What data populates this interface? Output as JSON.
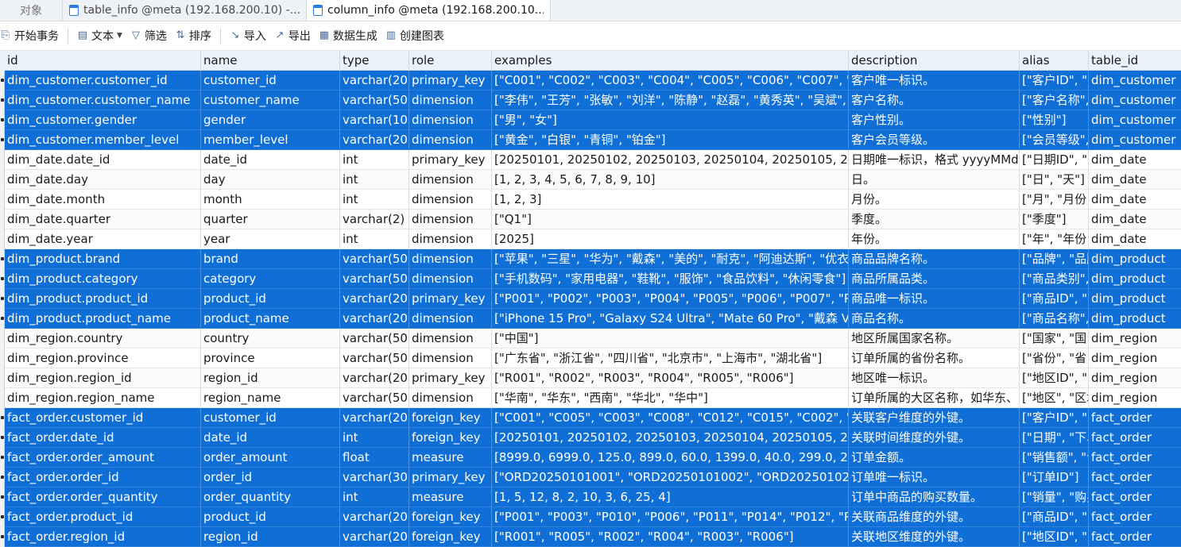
{
  "tabs": [
    {
      "label": "对象"
    },
    {
      "label": "table_info @meta (192.168.200.10) -..."
    },
    {
      "label": "column_info @meta (192.168.200.10..."
    }
  ],
  "toolbar": {
    "begin_transaction": "开始事务",
    "text": "文本",
    "filter": "筛选",
    "sort": "排序",
    "import": "导入",
    "export": "导出",
    "data_generation": "数据生成",
    "create_chart": "创建图表"
  },
  "grid": {
    "columns": [
      "id",
      "name",
      "type",
      "role",
      "examples",
      "description",
      "alias",
      "table_id"
    ],
    "rows": [
      {
        "selected": true,
        "id": "dim_customer.customer_id",
        "name": "customer_id",
        "type": "varchar(20)",
        "role": "primary_key",
        "examples": "[\"C001\", \"C002\", \"C003\", \"C004\", \"C005\", \"C006\", \"C007\", \"C0",
        "description": "客户唯一标识。",
        "alias": "[\"客户ID\", \"",
        "table_id": "dim_customer"
      },
      {
        "selected": true,
        "id": "dim_customer.customer_name",
        "name": "customer_name",
        "type": "varchar(50)",
        "role": "dimension",
        "examples": "[\"李伟\", \"王芳\", \"张敏\", \"刘洋\", \"陈静\", \"赵磊\", \"黄秀英\", \"吴斌\", \"",
        "description": "客户名称。",
        "alias": "[\"客户名称\",",
        "table_id": "dim_customer"
      },
      {
        "selected": true,
        "id": "dim_customer.gender",
        "name": "gender",
        "type": "varchar(10)",
        "role": "dimension",
        "examples": "[\"男\", \"女\"]",
        "description": "客户性别。",
        "alias": "[\"性别\"]",
        "table_id": "dim_customer"
      },
      {
        "selected": true,
        "id": "dim_customer.member_level",
        "name": "member_level",
        "type": "varchar(20)",
        "role": "dimension",
        "examples": "[\"黄金\", \"白银\", \"青铜\", \"铂金\"]",
        "description": "客户会员等级。",
        "alias": "[\"会员等级\",",
        "table_id": "dim_customer"
      },
      {
        "selected": false,
        "id": "dim_date.date_id",
        "name": "date_id",
        "type": "int",
        "role": "primary_key",
        "examples": "[20250101, 20250102, 20250103, 20250104, 20250105, 20250",
        "description": "日期唯一标识，格式 yyyyMMd",
        "alias": "[\"日期ID\", \"",
        "table_id": "dim_date"
      },
      {
        "selected": false,
        "id": "dim_date.day",
        "name": "day",
        "type": "int",
        "role": "dimension",
        "examples": "[1, 2, 3, 4, 5, 6, 7, 8, 9, 10]",
        "description": "日。",
        "alias": "[\"日\", \"天\"]",
        "table_id": "dim_date"
      },
      {
        "selected": false,
        "id": "dim_date.month",
        "name": "month",
        "type": "int",
        "role": "dimension",
        "examples": "[1, 2, 3]",
        "description": "月份。",
        "alias": "[\"月\", \"月份",
        "table_id": "dim_date"
      },
      {
        "selected": false,
        "id": "dim_date.quarter",
        "name": "quarter",
        "type": "varchar(2)",
        "role": "dimension",
        "examples": "[\"Q1\"]",
        "description": "季度。",
        "alias": "[\"季度\"]",
        "table_id": "dim_date"
      },
      {
        "selected": false,
        "id": "dim_date.year",
        "name": "year",
        "type": "int",
        "role": "dimension",
        "examples": "[2025]",
        "description": "年份。",
        "alias": "[\"年\", \"年份",
        "table_id": "dim_date"
      },
      {
        "selected": true,
        "id": "dim_product.brand",
        "name": "brand",
        "type": "varchar(50)",
        "role": "dimension",
        "examples": "[\"苹果\", \"三星\", \"华为\", \"戴森\", \"美的\", \"耐克\", \"阿迪达斯\", \"优衣库",
        "description": "商品品牌名称。",
        "alias": "[\"品牌\", \"品牌",
        "table_id": "dim_product"
      },
      {
        "selected": true,
        "id": "dim_product.category",
        "name": "category",
        "type": "varchar(50)",
        "role": "dimension",
        "examples": "[\"手机数码\", \"家用电器\", \"鞋靴\", \"服饰\", \"食品饮料\", \"休闲零食\"]",
        "description": "商品所属品类。",
        "alias": "[\"商品类别\",",
        "table_id": "dim_product"
      },
      {
        "selected": true,
        "id": "dim_product.product_id",
        "name": "product_id",
        "type": "varchar(20)",
        "role": "primary_key",
        "examples": "[\"P001\", \"P002\", \"P003\", \"P004\", \"P005\", \"P006\", \"P007\", \"P00",
        "description": "商品唯一标识。",
        "alias": "[\"商品ID\", \"",
        "table_id": "dim_product"
      },
      {
        "selected": true,
        "id": "dim_product.product_name",
        "name": "product_name",
        "type": "varchar(200",
        "role": "dimension",
        "examples": "[\"iPhone 15 Pro\", \"Galaxy S24 Ultra\", \"Mate 60 Pro\", \"戴森 V15",
        "description": "商品名称。",
        "alias": "[\"商品名称\",",
        "table_id": "dim_product"
      },
      {
        "selected": false,
        "id": "dim_region.country",
        "name": "country",
        "type": "varchar(50)",
        "role": "dimension",
        "examples": "[\"中国\"]",
        "description": "地区所属国家名称。",
        "alias": "[\"国家\", \"国",
        "table_id": "dim_region"
      },
      {
        "selected": false,
        "id": "dim_region.province",
        "name": "province",
        "type": "varchar(50)",
        "role": "dimension",
        "examples": "[\"广东省\", \"浙江省\", \"四川省\", \"北京市\", \"上海市\", \"湖北省\"]",
        "description": "订单所属的省份名称。",
        "alias": "[\"省份\", \"省",
        "table_id": "dim_region"
      },
      {
        "selected": false,
        "id": "dim_region.region_id",
        "name": "region_id",
        "type": "varchar(20)",
        "role": "primary_key",
        "examples": "[\"R001\", \"R002\", \"R003\", \"R004\", \"R005\", \"R006\"]",
        "description": "地区唯一标识。",
        "alias": "[\"地区ID\", \"",
        "table_id": "dim_region"
      },
      {
        "selected": false,
        "id": "dim_region.region_name",
        "name": "region_name",
        "type": "varchar(50)",
        "role": "dimension",
        "examples": "[\"华南\", \"华东\", \"西南\", \"华北\", \"华中\"]",
        "description": "订单所属的大区名称，如华东、",
        "alias": "[\"地区\", \"区域",
        "table_id": "dim_region"
      },
      {
        "selected": true,
        "id": "fact_order.customer_id",
        "name": "customer_id",
        "type": "varchar(20)",
        "role": "foreign_key",
        "examples": "[\"C001\", \"C005\", \"C003\", \"C008\", \"C012\", \"C015\", \"C002\", \"C0",
        "description": "关联客户维度的外键。",
        "alias": "[\"客户ID\", \"",
        "table_id": "fact_order"
      },
      {
        "selected": true,
        "id": "fact_order.date_id",
        "name": "date_id",
        "type": "int",
        "role": "foreign_key",
        "examples": "[20250101, 20250102, 20250103, 20250104, 20250105, 20250",
        "description": "关联时间维度的外键。",
        "alias": "[\"日期\", \"下单",
        "table_id": "fact_order"
      },
      {
        "selected": true,
        "id": "fact_order.order_amount",
        "name": "order_amount",
        "type": "float",
        "role": "measure",
        "examples": "[8999.0, 6999.0, 125.0, 899.0, 60.0, 1399.0, 40.0, 299.0, 200.0,",
        "description": "订单金额。",
        "alias": "[\"销售额\", \"订",
        "table_id": "fact_order"
      },
      {
        "selected": true,
        "id": "fact_order.order_id",
        "name": "order_id",
        "type": "varchar(30)",
        "role": "primary_key",
        "examples": "[\"ORD20250101001\", \"ORD20250101002\", \"ORD2025010200",
        "description": "订单唯一标识。",
        "alias": "[\"订单ID\"]",
        "table_id": "fact_order"
      },
      {
        "selected": true,
        "id": "fact_order.order_quantity",
        "name": "order_quantity",
        "type": "int",
        "role": "measure",
        "examples": "[1, 5, 12, 8, 2, 10, 3, 6, 25, 4]",
        "description": "订单中商品的购买数量。",
        "alias": "[\"销量\", \"购买",
        "table_id": "fact_order"
      },
      {
        "selected": true,
        "id": "fact_order.product_id",
        "name": "product_id",
        "type": "varchar(20)",
        "role": "foreign_key",
        "examples": "[\"P001\", \"P003\", \"P010\", \"P006\", \"P011\", \"P014\", \"P012\", \"P00",
        "description": "关联商品维度的外键。",
        "alias": "[\"商品ID\", \"",
        "table_id": "fact_order"
      },
      {
        "selected": true,
        "id": "fact_order.region_id",
        "name": "region_id",
        "type": "varchar(20)",
        "role": "foreign_key",
        "examples": "[\"R001\", \"R005\", \"R002\", \"R004\", \"R003\", \"R006\"]",
        "description": "关联地区维度的外键。",
        "alias": "[\"地区ID\", \"",
        "table_id": "fact_order"
      }
    ]
  },
  "colors": {
    "selection": "#0f6fd6",
    "header_bg": "#e9f2fb",
    "accent": "#2c7be5"
  },
  "icons": [
    "table-icon",
    "transaction-icon",
    "text-icon",
    "filter-icon",
    "sort-icon",
    "import-icon",
    "export-icon",
    "data-generation-icon",
    "chart-icon"
  ]
}
